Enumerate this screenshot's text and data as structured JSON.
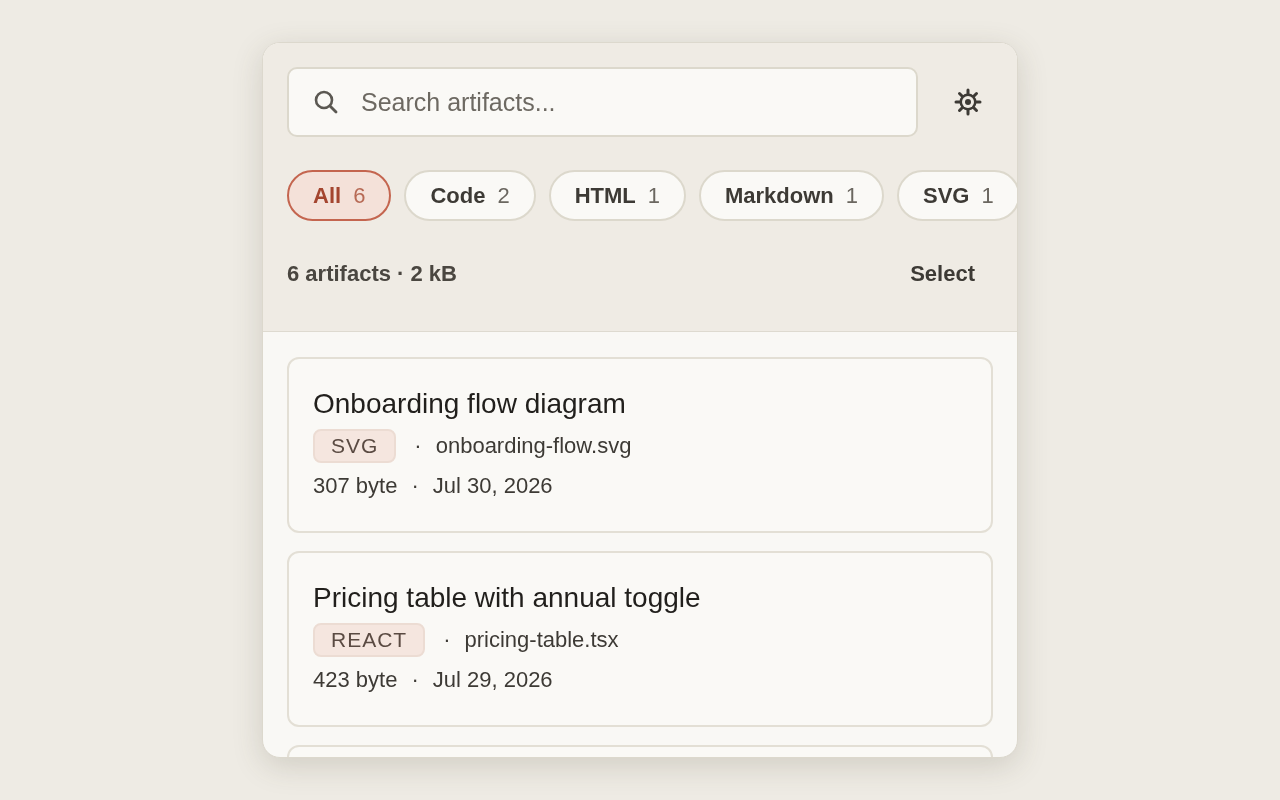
{
  "search": {
    "placeholder": "Search artifacts..."
  },
  "filters": [
    {
      "label": "All",
      "count": "6",
      "selected": true
    },
    {
      "label": "Code",
      "count": "2",
      "selected": false
    },
    {
      "label": "HTML",
      "count": "1",
      "selected": false
    },
    {
      "label": "Markdown",
      "count": "1",
      "selected": false
    },
    {
      "label": "SVG",
      "count": "1",
      "selected": false
    }
  ],
  "summary": "6 artifacts · 2 kB",
  "select_action": "Select",
  "artifacts": [
    {
      "title": "Onboarding flow diagram",
      "tag": "SVG",
      "tag_separator": "·",
      "file": "onboarding-flow.svg",
      "size": "307 byte",
      "meta_separator": "·",
      "date": "Jul 30, 2026"
    },
    {
      "title": "Pricing table with annual toggle",
      "tag": "REACT",
      "tag_separator": "·",
      "file": "pricing-table.tsx",
      "size": "423 byte",
      "meta_separator": "·",
      "date": "Jul 29, 2026"
    }
  ],
  "partial_card_below": true
}
